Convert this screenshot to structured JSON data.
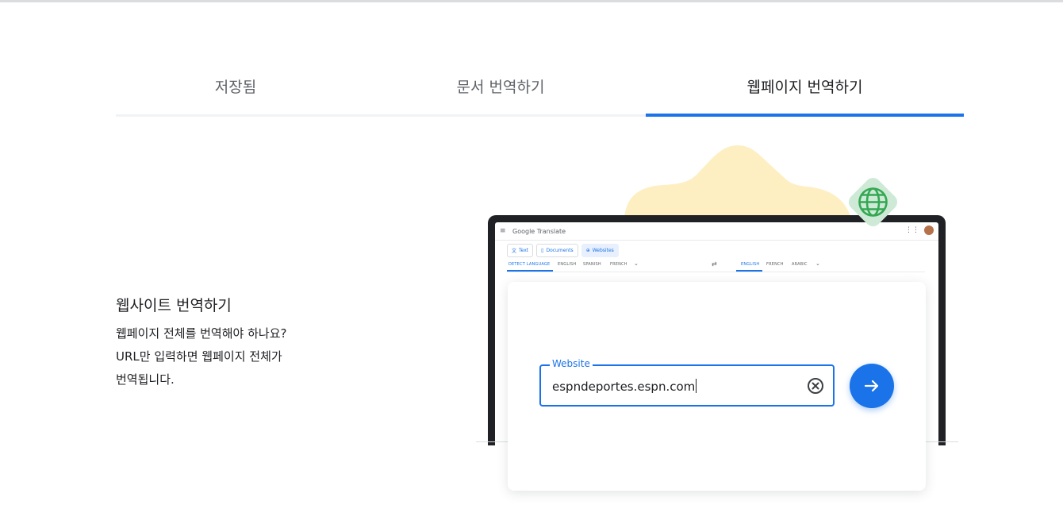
{
  "tabs": {
    "saved": "저장됨",
    "documents": "문서 번역하기",
    "webpages": "웹페이지 번역하기",
    "active": "webpages"
  },
  "feature": {
    "title": "웹사이트 번역하기",
    "desc_line1": "웹페이지 전체를 번역해야 하나요?",
    "desc_line2": "URL만 입력하면 웹페이지 전체가",
    "desc_line3": "번역됩니다."
  },
  "mock_app": {
    "brand_google": "Google",
    "brand_product": "Translate",
    "tabs": {
      "text": "Text",
      "documents": "Documents",
      "websites": "Websites"
    },
    "source_langs": [
      "DETECT LANGUAGE",
      "ENGLISH",
      "SPANISH",
      "FRENCH"
    ],
    "target_langs": [
      "ENGLISH",
      "FRENCH",
      "ARABIC"
    ]
  },
  "website_input": {
    "label": "Website",
    "value": "espndeportes.espn.com"
  },
  "colors": {
    "accent": "#1a73e8",
    "star": "#feefc3",
    "globe_bg": "#ceead6",
    "globe": "#34a853"
  },
  "icons": [
    "menu-icon",
    "apps-grid-icon",
    "globe-icon",
    "clear-icon",
    "arrow-right-icon",
    "swap-icon"
  ]
}
